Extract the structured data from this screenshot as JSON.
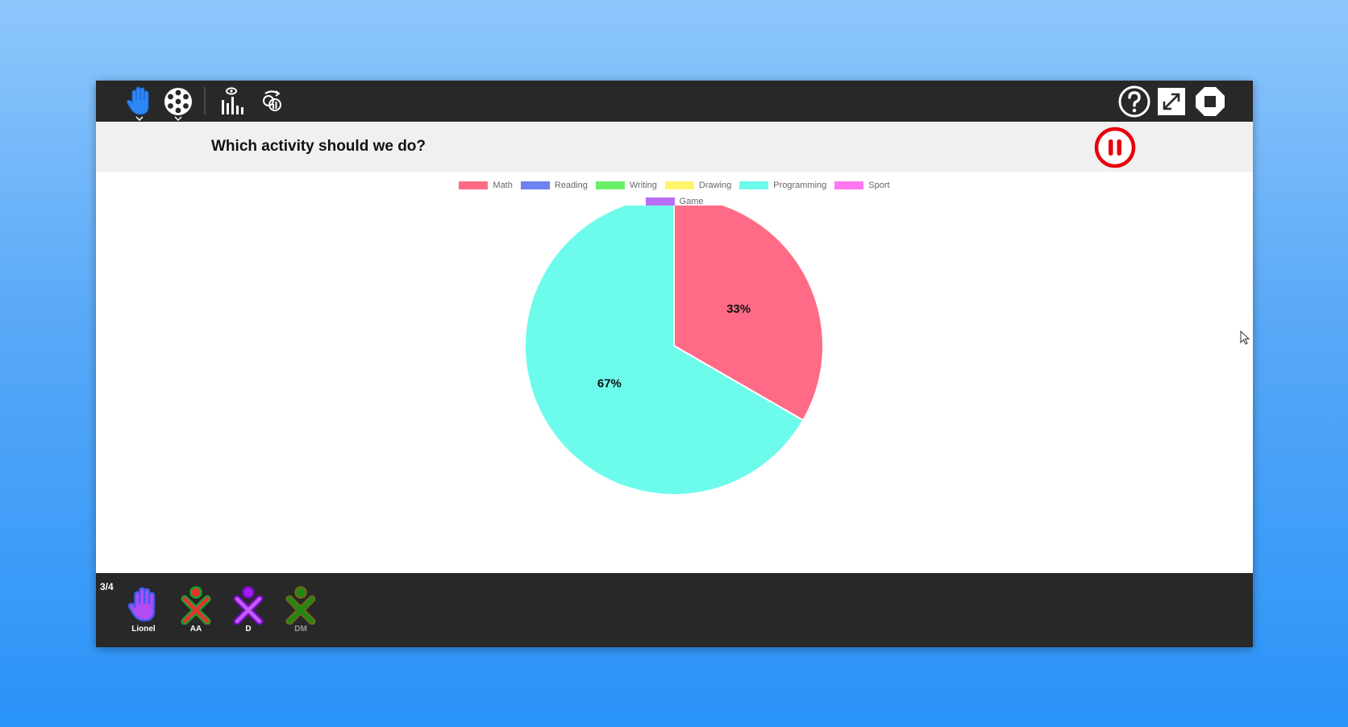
{
  "toolbar": {
    "left_buttons": [
      {
        "icon": "hand-icon",
        "color": "#2f86f6"
      },
      {
        "icon": "palette-icon"
      },
      {
        "icon": "chart-eye-icon"
      },
      {
        "icon": "sync-icon"
      }
    ],
    "right_buttons": [
      {
        "icon": "help-icon"
      },
      {
        "icon": "fullscreen-icon"
      },
      {
        "icon": "stop-icon"
      }
    ]
  },
  "question": {
    "text": "Which activity should we do?",
    "pause_color": "#e8000b"
  },
  "chart_data": {
    "type": "pie",
    "legend": [
      "Math",
      "Reading",
      "Writing",
      "Drawing",
      "Programming",
      "Sport",
      "Game"
    ],
    "colors": [
      "#ff6b87",
      "#6e82f2",
      "#68f06a",
      "#fff56a",
      "#6dfcec",
      "#ff78f0",
      "#b86df2"
    ],
    "values": [
      1,
      0,
      0,
      0,
      2,
      0,
      0
    ],
    "labels": [
      "33%",
      "",
      "",
      "",
      "67%",
      "",
      ""
    ],
    "legend_position": "top"
  },
  "footer": {
    "count": "3/4",
    "users": [
      {
        "name": "Lionel",
        "icon": "hand-icon",
        "stroke": "#3d5df2",
        "fill": "#b14cf2"
      },
      {
        "name": "AA",
        "icon": "xo-icon",
        "stroke": "#e53232",
        "fill": "#1ca02a"
      },
      {
        "name": "D",
        "icon": "xo-icon",
        "stroke": "#a31df2",
        "fill": "#7a0bc9"
      },
      {
        "name": "DM",
        "icon": "xo-icon",
        "stroke": "#1e8a14",
        "fill": "#6b6b1a"
      }
    ]
  }
}
